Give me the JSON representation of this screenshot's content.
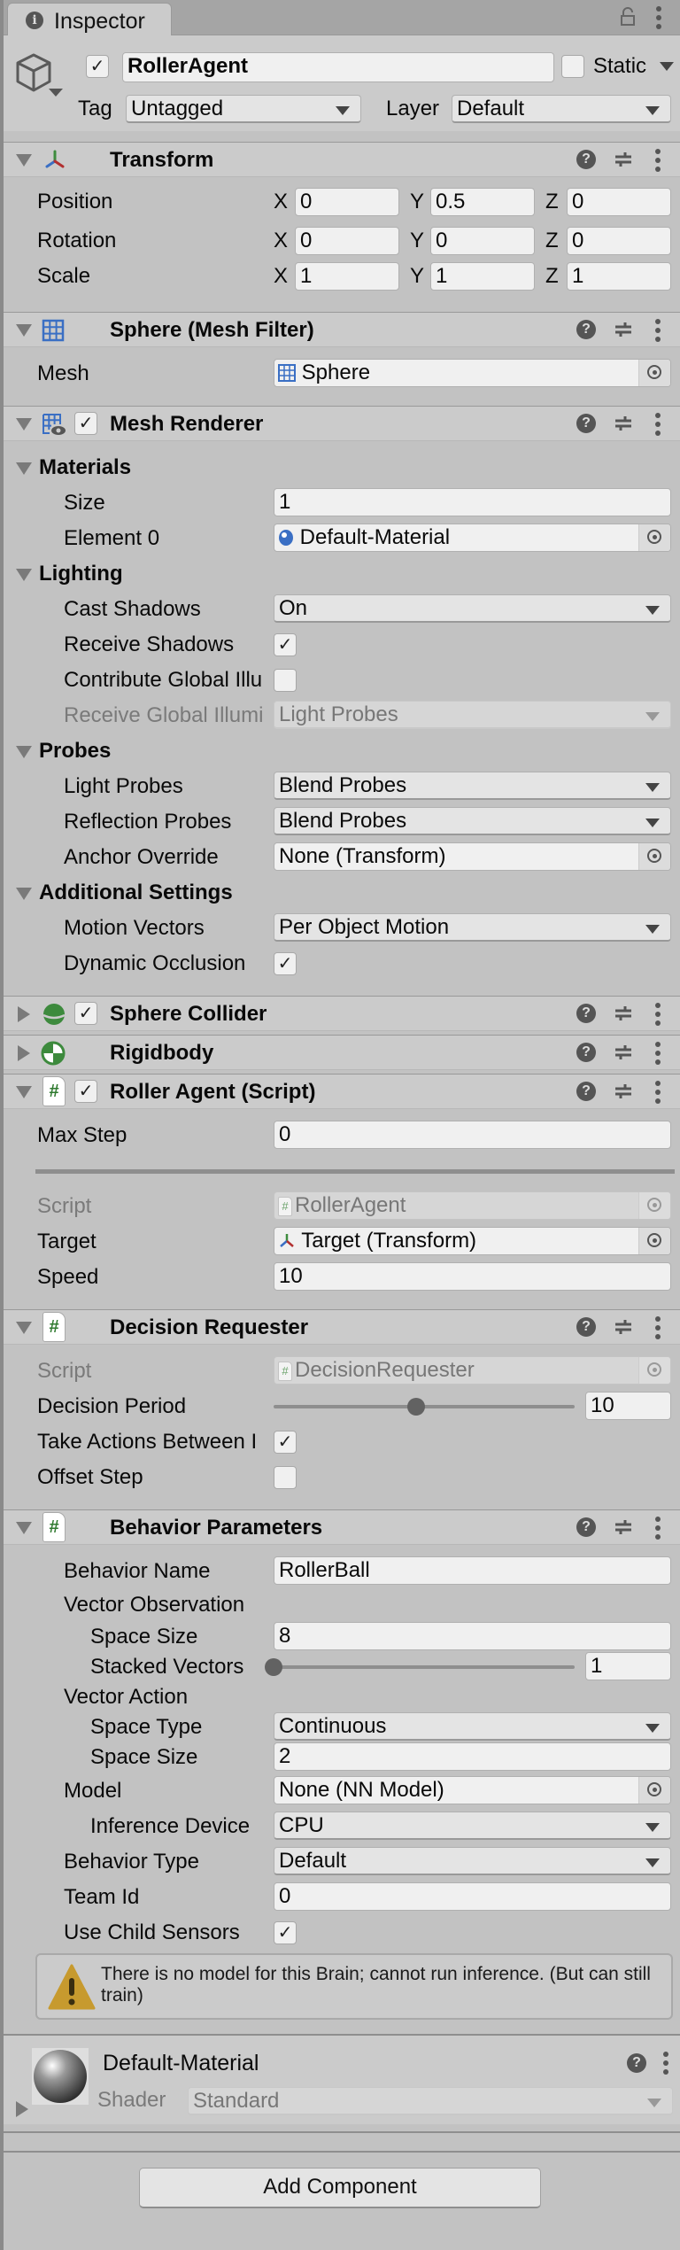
{
  "window": {
    "tab_label": "Inspector",
    "tab_icon": "info-icon",
    "lock_icon": "lock-icon",
    "menu_icon": "kebab-menu-icon"
  },
  "gameobject": {
    "icon": "cube-icon",
    "active": true,
    "name": "RollerAgent",
    "static_label": "Static",
    "static": false,
    "tag_label": "Tag",
    "tag_value": "Untagged",
    "layer_label": "Layer",
    "layer_value": "Default"
  },
  "transform": {
    "title": "Transform",
    "icon": "transform-axes-icon",
    "expanded": true,
    "rows": [
      {
        "label": "Position",
        "x": "0",
        "y": "0.5",
        "z": "0"
      },
      {
        "label": "Rotation",
        "x": "0",
        "y": "0",
        "z": "0"
      },
      {
        "label": "Scale",
        "x": "1",
        "y": "1",
        "z": "1"
      }
    ],
    "axis_labels": [
      "X",
      "Y",
      "Z"
    ]
  },
  "mesh_filter": {
    "title": "Sphere (Mesh Filter)",
    "icon": "mesh-grid-icon",
    "expanded": true,
    "mesh_label": "Mesh",
    "mesh_value": "Sphere"
  },
  "mesh_renderer": {
    "title": "Mesh Renderer",
    "icon": "mesh-renderer-icon",
    "enabled": true,
    "expanded": true,
    "materials": {
      "header": "Materials",
      "size_label": "Size",
      "size_value": "1",
      "element0_label": "Element 0",
      "element0_value": "Default-Material"
    },
    "lighting": {
      "header": "Lighting",
      "cast_shadows_label": "Cast Shadows",
      "cast_shadows_value": "On",
      "receive_shadows_label": "Receive Shadows",
      "receive_shadows": true,
      "contribute_gi_label": "Contribute Global Illu",
      "contribute_gi": false,
      "receive_gi_label": "Receive Global Illumi",
      "receive_gi_value": "Light Probes"
    },
    "probes": {
      "header": "Probes",
      "light_probes_label": "Light Probes",
      "light_probes_value": "Blend Probes",
      "reflection_probes_label": "Reflection Probes",
      "reflection_probes_value": "Blend Probes",
      "anchor_override_label": "Anchor Override",
      "anchor_override_value": "None (Transform)"
    },
    "additional": {
      "header": "Additional Settings",
      "motion_vectors_label": "Motion Vectors",
      "motion_vectors_value": "Per Object Motion",
      "dynamic_occlusion_label": "Dynamic Occlusion",
      "dynamic_occlusion": true
    }
  },
  "sphere_collider": {
    "title": "Sphere Collider",
    "icon": "sphere-collider-icon",
    "enabled": true,
    "expanded": false
  },
  "rigidbody": {
    "title": "Rigidbody",
    "icon": "rigidbody-icon",
    "expanded": false
  },
  "roller_agent": {
    "title": "Roller Agent (Script)",
    "icon": "script-hash-icon",
    "enabled": true,
    "expanded": true,
    "max_step_label": "Max Step",
    "max_step_value": "0",
    "script_label": "Script",
    "script_value": "RollerAgent",
    "target_label": "Target",
    "target_value": "Target (Transform)",
    "speed_label": "Speed",
    "speed_value": "10"
  },
  "decision_requester": {
    "title": "Decision Requester",
    "icon": "script-hash-icon",
    "expanded": true,
    "script_label": "Script",
    "script_value": "DecisionRequester",
    "decision_period_label": "Decision Period",
    "decision_period_value": "10",
    "decision_period_min": 1,
    "decision_period_max": 20,
    "take_actions_label": "Take Actions Between I",
    "take_actions": true,
    "offset_step_label": "Offset Step",
    "offset_step": false
  },
  "behavior_parameters": {
    "title": "Behavior Parameters",
    "icon": "script-hash-icon",
    "expanded": true,
    "behavior_name_label": "Behavior Name",
    "behavior_name_value": "RollerBall",
    "vector_observation_label": "Vector Observation",
    "obs_space_size_label": "Space Size",
    "obs_space_size_value": "8",
    "stacked_vectors_label": "Stacked Vectors",
    "stacked_vectors_value": "1",
    "stacked_vectors_min": 1,
    "stacked_vectors_max": 50,
    "vector_action_label": "Vector Action",
    "space_type_label": "Space Type",
    "space_type_value": "Continuous",
    "act_space_size_label": "Space Size",
    "act_space_size_value": "2",
    "model_label": "Model",
    "model_value": "None (NN Model)",
    "inference_device_label": "Inference Device",
    "inference_device_value": "CPU",
    "behavior_type_label": "Behavior Type",
    "behavior_type_value": "Default",
    "team_id_label": "Team Id",
    "team_id_value": "0",
    "use_child_sensors_label": "Use Child Sensors",
    "use_child_sensors": true,
    "warning_text": "There is no model for this Brain; cannot run inference. (But can still train)"
  },
  "material": {
    "name": "Default-Material",
    "shader_label": "Shader",
    "shader_value": "Standard"
  },
  "add_component_label": "Add Component",
  "colors": {
    "panel_bg": "#c2c2c2",
    "header_bg": "#cbcbcb",
    "field_bg": "#f0f0f0",
    "script_green": "#2f7a2f",
    "mesh_blue": "#3a6fc4",
    "warning_yellow": "#c79a2e"
  }
}
